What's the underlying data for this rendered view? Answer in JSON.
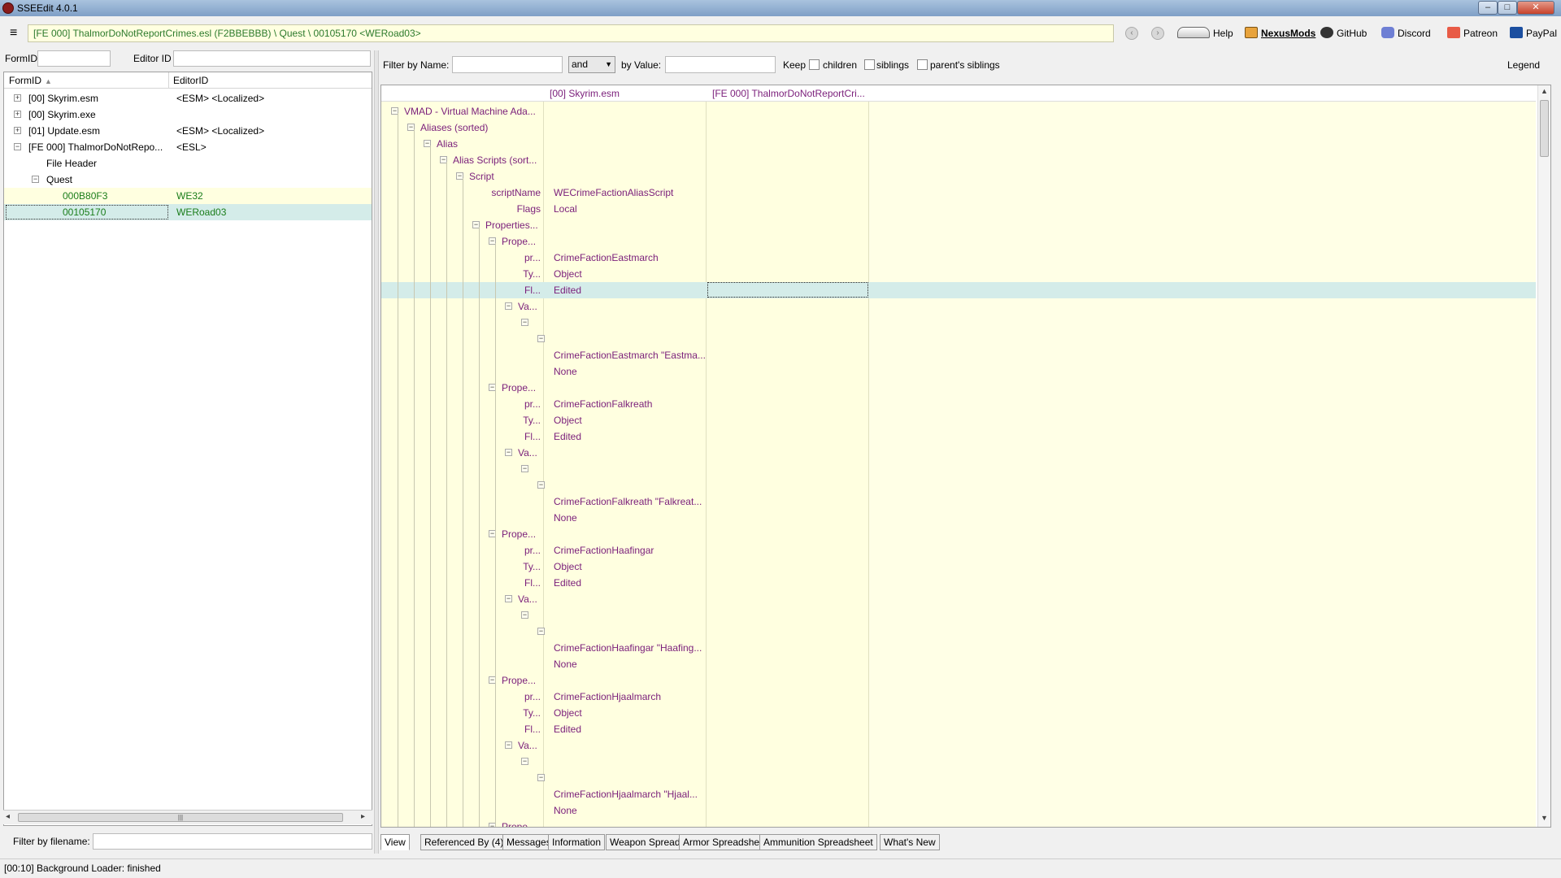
{
  "window": {
    "title": "SSEEdit 4.0.1"
  },
  "toolbar": {
    "path": "[FE 000] ThalmorDoNotReportCrimes.esl (F2BBEBBB) \\ Quest \\ 00105170 <WERoad03>",
    "help": "Help",
    "nexusmods": "NexusMods",
    "github": "GitHub",
    "discord": "Discord",
    "patreon": "Patreon",
    "paypal": "PayPal"
  },
  "left": {
    "formid_label": "FormID",
    "editorid_label": "Editor ID",
    "col_formid": "FormID",
    "col_editorid": "EditorID",
    "rows": [
      {
        "formid": "[00] Skyrim.esm",
        "editorid": "<ESM> <Localized>"
      },
      {
        "formid": "[00] Skyrim.exe",
        "editorid": ""
      },
      {
        "formid": "[01] Update.esm",
        "editorid": "<ESM> <Localized>"
      },
      {
        "formid": "[FE 000] ThalmorDoNotRepo...",
        "editorid": "<ESL>"
      },
      {
        "formid": "File Header",
        "editorid": ""
      },
      {
        "formid": "Quest",
        "editorid": ""
      },
      {
        "formid": "000B80F3",
        "editorid": "WE32"
      },
      {
        "formid": "00105170",
        "editorid": "WERoad03"
      }
    ],
    "filter_filename_label": "Filter by filename:"
  },
  "right": {
    "filter_name_label": "Filter by Name:",
    "and_select": "and",
    "by_value_label": "by Value:",
    "keep_label": "Keep",
    "children_label": "children",
    "siblings_label": "siblings",
    "parents_siblings_label": "parent's siblings",
    "legend_label": "Legend",
    "col_skyrim": "[00] Skyrim.esm",
    "col_fe": "[FE 000] ThalmorDoNotReportCri...",
    "rows": [
      {
        "name": "VMAD - Virtual Machine Ada...",
        "value": ""
      },
      {
        "name": "Aliases (sorted)",
        "value": ""
      },
      {
        "name": "Alias",
        "value": ""
      },
      {
        "name": "Alias Scripts (sort...",
        "value": ""
      },
      {
        "name": "Script",
        "value": ""
      },
      {
        "name": "scriptName",
        "value": "WECrimeFactionAliasScript"
      },
      {
        "name": "Flags",
        "value": "Local"
      },
      {
        "name": "Properties...",
        "value": ""
      },
      {
        "name": "Prope...",
        "value": ""
      },
      {
        "name": "pr...",
        "value": "CrimeFactionEastmarch"
      },
      {
        "name": "Ty...",
        "value": "Object"
      },
      {
        "name": "Fl...",
        "value": "Edited"
      },
      {
        "name": "Va...",
        "value": ""
      },
      {
        "name": "",
        "value": ""
      },
      {
        "name": "",
        "value": ""
      },
      {
        "name": "",
        "value": "CrimeFactionEastmarch \"Eastma..."
      },
      {
        "name": "",
        "value": "None"
      },
      {
        "name": "Prope...",
        "value": ""
      },
      {
        "name": "pr...",
        "value": "CrimeFactionFalkreath"
      },
      {
        "name": "Ty...",
        "value": "Object"
      },
      {
        "name": "Fl...",
        "value": "Edited"
      },
      {
        "name": "Va...",
        "value": ""
      },
      {
        "name": "",
        "value": ""
      },
      {
        "name": "",
        "value": ""
      },
      {
        "name": "",
        "value": "CrimeFactionFalkreath \"Falkreat..."
      },
      {
        "name": "",
        "value": "None"
      },
      {
        "name": "Prope...",
        "value": ""
      },
      {
        "name": "pr...",
        "value": "CrimeFactionHaafingar"
      },
      {
        "name": "Ty...",
        "value": "Object"
      },
      {
        "name": "Fl...",
        "value": "Edited"
      },
      {
        "name": "Va...",
        "value": ""
      },
      {
        "name": "",
        "value": ""
      },
      {
        "name": "",
        "value": ""
      },
      {
        "name": "",
        "value": "CrimeFactionHaafingar \"Haafing..."
      },
      {
        "name": "",
        "value": "None"
      },
      {
        "name": "Prope...",
        "value": ""
      },
      {
        "name": "pr...",
        "value": "CrimeFactionHjaalmarch"
      },
      {
        "name": "Ty...",
        "value": "Object"
      },
      {
        "name": "Fl...",
        "value": "Edited"
      },
      {
        "name": "Va...",
        "value": ""
      },
      {
        "name": "",
        "value": ""
      },
      {
        "name": "",
        "value": ""
      },
      {
        "name": "",
        "value": "CrimeFactionHjaalmarch \"Hjaal..."
      },
      {
        "name": "",
        "value": "None"
      },
      {
        "name": "Prope...",
        "value": ""
      }
    ]
  },
  "tabs": [
    "View",
    "Referenced By (4)",
    "Messages",
    "Information",
    "Weapon Spreadsheet",
    "Armor Spreadsheet",
    "Ammunition Spreadsheet",
    "What's New"
  ],
  "status": {
    "text": "[00:10] Background Loader: finished"
  }
}
